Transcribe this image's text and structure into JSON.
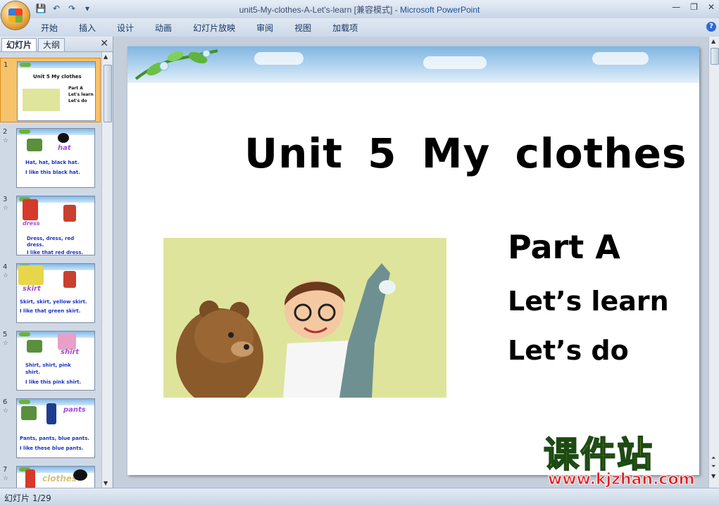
{
  "window": {
    "title_doc": "unit5-My-clothes-A-Let's-learn [兼容模式] - ",
    "title_app": "Microsoft PowerPoint"
  },
  "ribbon": {
    "tabs": [
      "开始",
      "插入",
      "设计",
      "动画",
      "幻灯片放映",
      "审阅",
      "视图",
      "加载项"
    ]
  },
  "pane": {
    "tab_slides": "幻灯片",
    "tab_outline": "大纲",
    "close": "✕"
  },
  "thumbs": [
    {
      "num": "1",
      "title": "Unit 5   My clothes",
      "lines": [
        "Part A",
        "Let's learn",
        "Let's do"
      ]
    },
    {
      "num": "2",
      "word": "hat",
      "lines": [
        "Hat, hat, black hat.",
        "I like this black hat."
      ]
    },
    {
      "num": "3",
      "word": "dress",
      "lines": [
        "Dress, dress, red",
        "dress.",
        "I like that red dress."
      ]
    },
    {
      "num": "4",
      "word": "skirt",
      "lines": [
        "Skirt, skirt, yellow skirt.",
        "I like that green skirt."
      ]
    },
    {
      "num": "5",
      "word": "shirt",
      "lines": [
        "Shirt, shirt, pink",
        "shirt.",
        "I like this pink shirt."
      ]
    },
    {
      "num": "6",
      "word": "pants",
      "lines": [
        "Pants, pants, blue pants.",
        "I like these blue pants."
      ]
    },
    {
      "num": "7",
      "word": "clothes"
    }
  ],
  "slide": {
    "title": "Unit 5   My clothes",
    "part": "Part A",
    "line1": "Let’s learn",
    "line2": "Let’s do"
  },
  "status": {
    "slide_counter": "幻灯片 1/29"
  },
  "watermark": {
    "cn": "课件站",
    "url": "www.kjzhan.com"
  }
}
